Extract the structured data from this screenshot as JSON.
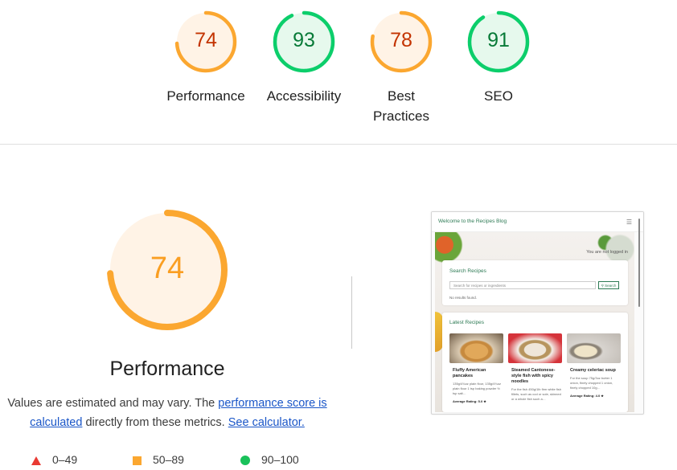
{
  "gauges": [
    {
      "score": "74",
      "label": "Performance",
      "ring": "#fba730",
      "fill": "#fff3e6",
      "text": "#c33300",
      "fraction": 0.74
    },
    {
      "score": "93",
      "label": "Accessibility",
      "ring": "#0cce6b",
      "fill": "#e6f9ed",
      "text": "#077a37",
      "fraction": 0.93
    },
    {
      "score": "78",
      "label": "Best Practices",
      "ring": "#fba730",
      "fill": "#fff3e6",
      "text": "#c33300",
      "fraction": 0.78
    },
    {
      "score": "91",
      "label": "SEO",
      "ring": "#0cce6b",
      "fill": "#e6f9ed",
      "text": "#077a37",
      "fraction": 0.91
    }
  ],
  "performance": {
    "score": "74",
    "fraction": 0.74,
    "title": "Performance",
    "ring": "#fba730",
    "fill": "#fff3e6",
    "desc_prefix": "Values are estimated and may vary. The ",
    "desc_link1": "performance score is calculated",
    "desc_mid": " directly from these metrics. ",
    "desc_link2": "See calculator."
  },
  "legend": [
    {
      "range": "0–49",
      "shape": "triangle",
      "color": "#e93a33"
    },
    {
      "range": "50–89",
      "shape": "square",
      "color": "#fba730"
    },
    {
      "range": "90–100",
      "shape": "circle",
      "color": "#19c15a"
    }
  ],
  "screenshot": {
    "brand": "Welcome to the Recipes Blog",
    "menu_icon": "hamburger-icon",
    "user_status": "You are not logged in",
    "search_title": "Search Recipes",
    "search_placeholder": "Search for recipes or ingredients",
    "search_button": "Search",
    "no_results": "No results found.",
    "latest_title": "Latest Recipes",
    "recipes": [
      {
        "name": "Fluffy American pancakes",
        "text": "135g/4¾oz plain flour, 135g/4¾oz plain flour 1 tsp baking powder ½ tsp salt…",
        "rating": "Average Rating: 5.0 ★"
      },
      {
        "name": "Steamed Cantonese-style fish with spicy noodles",
        "text": "For the fish 450g/1lb firm white fish fillets, such as cod or sole, skinned or a whole fish such a…",
        "rating": ""
      },
      {
        "name": "Creamy celeriac soup",
        "text": "For the soup 75g/3oz butter 1 onion, finely chopped 1 onion, finely chopped 10g…",
        "rating": "Average Rating: 4.0 ★"
      }
    ]
  }
}
